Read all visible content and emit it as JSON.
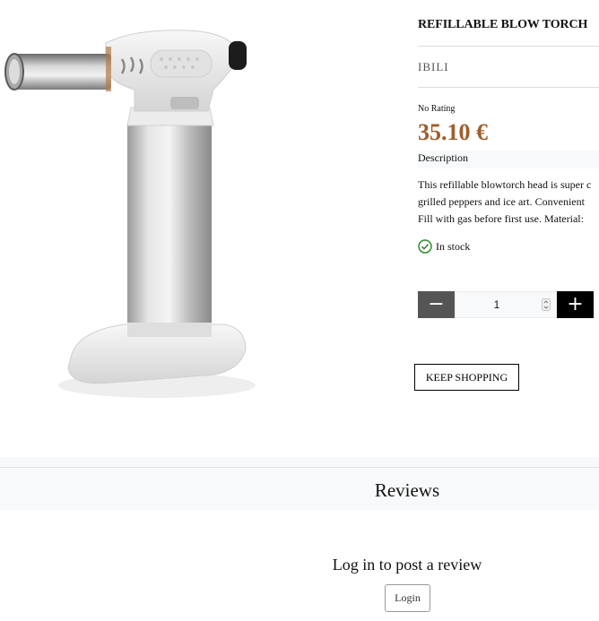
{
  "product": {
    "title": "REFILLABLE BLOW TORCH",
    "brand": "IBILI",
    "rating": "No Rating",
    "price": "35.10 €",
    "description_heading": "Description",
    "description_lines": [
      "This refillable blowtorch head is super c",
      "grilled peppers and ice art. Convenient",
      "Fill with gas before first use. Material:"
    ],
    "stock": "In stock",
    "quantity": "1",
    "minus_label": "−",
    "plus_label": "+",
    "keep_shopping": "KEEP SHOPPING"
  },
  "reviews": {
    "title": "Reviews",
    "login_prompt": "Log in to post a review",
    "login_button": "Login"
  },
  "colors": {
    "price": "#a05e2c",
    "stock_icon": "#2e8b2e",
    "minus_bg": "#555555",
    "plus_bg": "#000000"
  }
}
